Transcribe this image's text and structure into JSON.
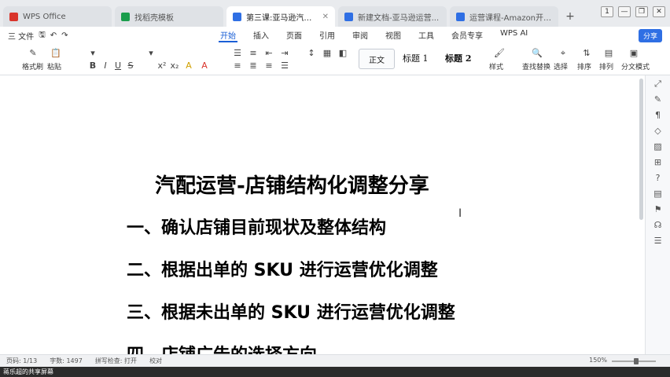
{
  "tabs": [
    {
      "label": "WPS Office",
      "color": "#d9342b",
      "active": false
    },
    {
      "label": "找稻壳模板",
      "color": "#1a9d4c",
      "active": false
    },
    {
      "label": "第三课:亚马逊汽配运营思路",
      "color": "#2f6fe4",
      "active": true
    },
    {
      "label": "新建文档-亚马逊运营...",
      "color": "#2f6fe4",
      "active": false
    },
    {
      "label": "运营课程-Amazon开店运营",
      "color": "#2f6fe4",
      "active": false
    }
  ],
  "newtab_symbol": "+",
  "window_buttons": [
    "1",
    "—",
    "❐",
    "✕"
  ],
  "menu": {
    "file_label": "三 文件",
    "tabs": [
      "开始",
      "插入",
      "页面",
      "引用",
      "审阅",
      "视图",
      "工具",
      "会员专享",
      "WPS AI"
    ],
    "active_tab": "开始",
    "share_label": "分享"
  },
  "ribbon": {
    "format_painter": "格式刷",
    "paste": "粘贴",
    "style_normal": "正文",
    "heading1": "标题 1",
    "heading2": "标题 2",
    "style_label": "样式",
    "find_replace": "查找替换",
    "select": "选择",
    "sort": "排序",
    "layout": "排列",
    "text_style": "分文模式"
  },
  "document": {
    "title": "汽配运营-店铺结构化调整分享",
    "lines": [
      "一、确认店铺目前现状及整体结构",
      "二、根据出单的 SKU 进行运营优化调整",
      "三、根据未出单的 SKU 进行运营优化调整",
      "四、店铺广告的选择方向"
    ]
  },
  "statusbar": {
    "page": "页码: 1/13",
    "words": "字数: 1497",
    "spell": "拼写检查: 打开",
    "proof": "校对",
    "zoom": "150%"
  },
  "banner": {
    "text": "蒋乐超的共享屏幕"
  },
  "colors": {
    "accent": "#2f6fe4",
    "wps_red": "#d9342b"
  }
}
